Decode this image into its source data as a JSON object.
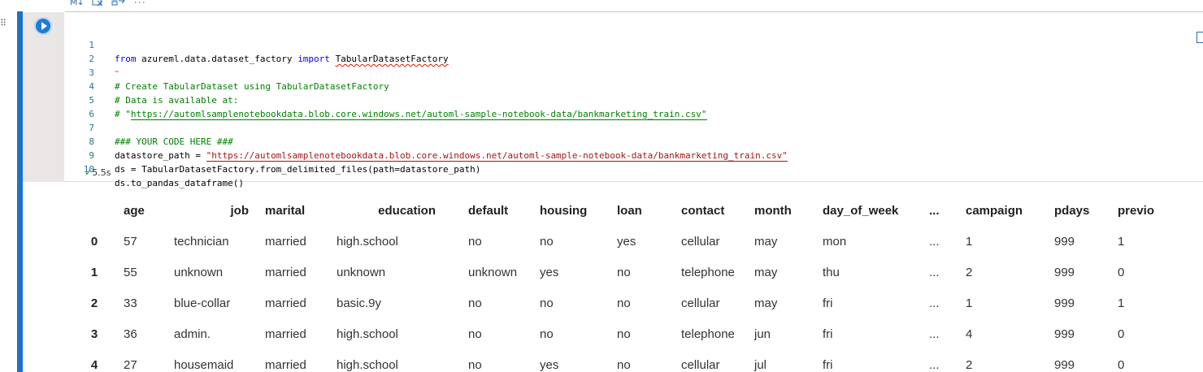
{
  "toolbar": {
    "markdown_label": "M↓",
    "more_label": "···"
  },
  "code": {
    "lines": [
      {
        "num": "1"
      },
      {
        "num": "2"
      },
      {
        "num": "3"
      },
      {
        "num": "4"
      },
      {
        "num": "5"
      },
      {
        "num": "6"
      },
      {
        "num": "7"
      },
      {
        "num": "8"
      },
      {
        "num": "9"
      },
      {
        "num": "10"
      }
    ],
    "l1_from": "from",
    "l1_module": " azureml.data.dataset_factory ",
    "l1_import": "import",
    "l1_space": " ",
    "l1_name": "TabularDatasetFactory",
    "l2_mark": "~",
    "l3": "# Create TabularDataset using TabularDatasetFactory",
    "l4": "# Data is available at:",
    "l5_prefix": "# \"",
    "l5_url": "https://automlsamplenotebookdata.blob.core.windows.net/automl-sample-notebook-data/bankmarketing_train.csv\"",
    "l7": "### YOUR CODE HERE ###",
    "l8_prefix": "datastore_path = ",
    "l8_str": "\"https://automlsamplenotebookdata.blob.core.windows.net/automl-sample-notebook-data/bankmarketing_train.csv\"",
    "l9": "ds = TabularDatasetFactory.from_delimited_files(path=datastore_path)",
    "l10": "ds.to_pandas_dataframe()"
  },
  "execution": {
    "check": "✓",
    "time": "5.5s"
  },
  "table": {
    "headers": [
      "",
      "age",
      "job",
      "marital",
      "education",
      "default",
      "housing",
      "loan",
      "contact",
      "month",
      "day_of_week",
      "...",
      "campaign",
      "pdays",
      "previo"
    ],
    "rows": [
      [
        "0",
        "57",
        "technician",
        "married",
        "high.school",
        "no",
        "no",
        "yes",
        "cellular",
        "may",
        "mon",
        "...",
        "1",
        "999",
        "1"
      ],
      [
        "1",
        "55",
        "unknown",
        "married",
        "unknown",
        "unknown",
        "yes",
        "no",
        "telephone",
        "may",
        "thu",
        "...",
        "2",
        "999",
        "0"
      ],
      [
        "2",
        "33",
        "blue-collar",
        "married",
        "basic.9y",
        "no",
        "no",
        "no",
        "cellular",
        "may",
        "fri",
        "...",
        "1",
        "999",
        "1"
      ],
      [
        "3",
        "36",
        "admin.",
        "married",
        "high.school",
        "no",
        "no",
        "no",
        "telephone",
        "jun",
        "fri",
        "...",
        "4",
        "999",
        "0"
      ],
      [
        "4",
        "27",
        "housemaid",
        "married",
        "high.school",
        "no",
        "yes",
        "no",
        "cellular",
        "jul",
        "fri",
        "...",
        "2",
        "999",
        "0"
      ]
    ]
  }
}
